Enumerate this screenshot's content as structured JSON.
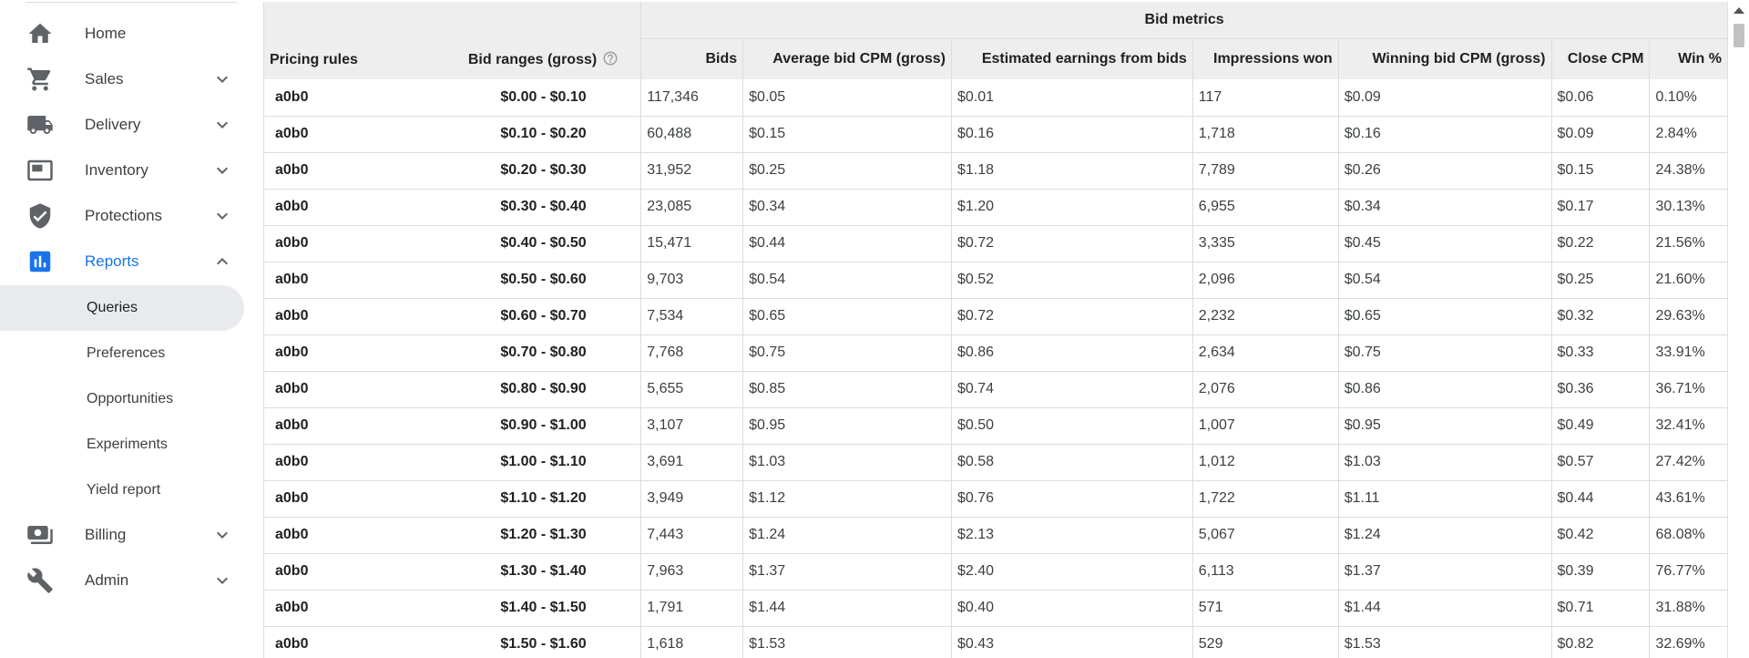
{
  "sidebar": {
    "items": [
      {
        "label": "Home",
        "icon": "home-icon",
        "chevron": "none"
      },
      {
        "label": "Sales",
        "icon": "cart-icon",
        "chevron": "down"
      },
      {
        "label": "Delivery",
        "icon": "truck-icon",
        "chevron": "down"
      },
      {
        "label": "Inventory",
        "icon": "inventory-icon",
        "chevron": "down"
      },
      {
        "label": "Protections",
        "icon": "shield-icon",
        "chevron": "down"
      },
      {
        "label": "Reports",
        "icon": "bar-chart-icon",
        "chevron": "up"
      }
    ],
    "report_subitems": [
      "Queries",
      "Preferences",
      "Opportunities",
      "Experiments",
      "Yield report"
    ],
    "bottom_items": [
      {
        "label": "Billing",
        "icon": "billing-icon",
        "chevron": "down"
      },
      {
        "label": "Admin",
        "icon": "wrench-icon",
        "chevron": "down"
      }
    ],
    "active_color": "#1a73e8"
  },
  "table": {
    "group_header": "Bid metrics",
    "headers": {
      "pricing_rules": "Pricing rules",
      "bid_ranges": "Bid ranges (gross)",
      "bids": "Bids",
      "avg_bid_cpm": "Average bid CPM (gross)",
      "est_earnings": "Estimated earnings from bids",
      "impressions_won": "Impressions won",
      "winning_bid_cpm": "Winning bid CPM (gross)",
      "close_cpm": "Close CPM",
      "win_pct": "Win %"
    },
    "rows": [
      [
        "a0b0",
        "$0.00 - $0.10",
        "117,346",
        "$0.05",
        "$0.01",
        "117",
        "$0.09",
        "$0.06",
        "0.10%"
      ],
      [
        "a0b0",
        "$0.10 - $0.20",
        "60,488",
        "$0.15",
        "$0.16",
        "1,718",
        "$0.16",
        "$0.09",
        "2.84%"
      ],
      [
        "a0b0",
        "$0.20 - $0.30",
        "31,952",
        "$0.25",
        "$1.18",
        "7,789",
        "$0.26",
        "$0.15",
        "24.38%"
      ],
      [
        "a0b0",
        "$0.30 - $0.40",
        "23,085",
        "$0.34",
        "$1.20",
        "6,955",
        "$0.34",
        "$0.17",
        "30.13%"
      ],
      [
        "a0b0",
        "$0.40 - $0.50",
        "15,471",
        "$0.44",
        "$0.72",
        "3,335",
        "$0.45",
        "$0.22",
        "21.56%"
      ],
      [
        "a0b0",
        "$0.50 - $0.60",
        "9,703",
        "$0.54",
        "$0.52",
        "2,096",
        "$0.54",
        "$0.25",
        "21.60%"
      ],
      [
        "a0b0",
        "$0.60 - $0.70",
        "7,534",
        "$0.65",
        "$0.72",
        "2,232",
        "$0.65",
        "$0.32",
        "29.63%"
      ],
      [
        "a0b0",
        "$0.70 - $0.80",
        "7,768",
        "$0.75",
        "$0.86",
        "2,634",
        "$0.75",
        "$0.33",
        "33.91%"
      ],
      [
        "a0b0",
        "$0.80 - $0.90",
        "5,655",
        "$0.85",
        "$0.74",
        "2,076",
        "$0.86",
        "$0.36",
        "36.71%"
      ],
      [
        "a0b0",
        "$0.90 - $1.00",
        "3,107",
        "$0.95",
        "$0.50",
        "1,007",
        "$0.95",
        "$0.49",
        "32.41%"
      ],
      [
        "a0b0",
        "$1.00 - $1.10",
        "3,691",
        "$1.03",
        "$0.58",
        "1,012",
        "$1.03",
        "$0.57",
        "27.42%"
      ],
      [
        "a0b0",
        "$1.10 - $1.20",
        "3,949",
        "$1.12",
        "$0.76",
        "1,722",
        "$1.11",
        "$0.44",
        "43.61%"
      ],
      [
        "a0b0",
        "$1.20 - $1.30",
        "7,443",
        "$1.24",
        "$2.13",
        "5,067",
        "$1.24",
        "$0.42",
        "68.08%"
      ],
      [
        "a0b0",
        "$1.30 - $1.40",
        "7,963",
        "$1.37",
        "$2.40",
        "6,113",
        "$1.37",
        "$0.39",
        "76.77%"
      ],
      [
        "a0b0",
        "$1.40 - $1.50",
        "1,791",
        "$1.44",
        "$0.40",
        "571",
        "$1.44",
        "$0.71",
        "31.88%"
      ],
      [
        "a0b0",
        "$1.50 - $1.60",
        "1,618",
        "$1.53",
        "$0.43",
        "529",
        "$1.53",
        "$0.82",
        "32.69%"
      ]
    ]
  }
}
